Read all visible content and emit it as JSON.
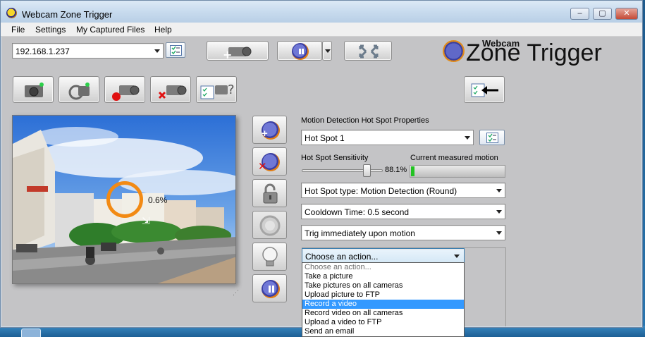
{
  "window": {
    "title": "Webcam Zone Trigger"
  },
  "menu": [
    "File",
    "Settings",
    "My Captured Files",
    "Help"
  ],
  "toolbar": {
    "camera_address": "192.168.1.237"
  },
  "logo": {
    "small": "Webcam",
    "big": "Zone Trigger"
  },
  "preview": {
    "hotspot_percent": "0.6%"
  },
  "hotspot_panel": {
    "heading": "Motion Detection Hot Spot Properties",
    "hotspot_select": "Hot Spot 1",
    "sensitivity_label": "Hot Spot Sensitivity",
    "sensitivity_value": "88.1%",
    "sensitivity_level": 0.881,
    "motion_label": "Current measured motion",
    "motion_level": 0.04,
    "type_select": "Hot Spot type: Motion Detection (Round)",
    "cooldown_select": "Cooldown Time: 0.5 second",
    "trigger_select": "Trig immediately upon motion",
    "action_select": "Choose an action...",
    "action_options": [
      "Choose an action...",
      "Take a picture",
      "Take pictures on all cameras",
      "Upload picture to FTP",
      "Record a video",
      "Record video on all cameras",
      "Upload a video to FTP",
      "Send an email"
    ],
    "action_selected_index": 4
  },
  "colors": {
    "hotspot_ring": "#f28a14",
    "selection": "#3399ff",
    "motion_meter": "#22c322"
  }
}
